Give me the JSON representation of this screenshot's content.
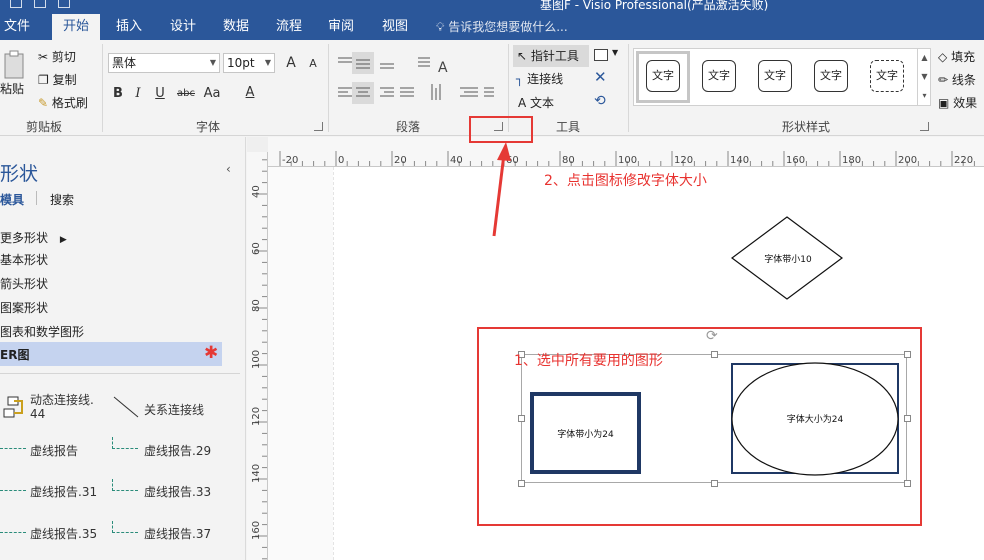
{
  "window": {
    "title": "基图F - Visio Professional(产品激活失败)"
  },
  "menu": {
    "tabs": [
      {
        "label": "文件",
        "active": false
      },
      {
        "label": "开始",
        "active": true
      },
      {
        "label": "插入",
        "active": false
      },
      {
        "label": "设计",
        "active": false
      },
      {
        "label": "数据",
        "active": false
      },
      {
        "label": "流程",
        "active": false
      },
      {
        "label": "审阅",
        "active": false
      },
      {
        "label": "视图",
        "active": false
      }
    ],
    "tell_me": "告诉我您想要做什么..."
  },
  "ribbon": {
    "clipboard": {
      "paste": "粘贴",
      "cut": "剪切",
      "copy": "复制",
      "format_painter": "格式刷",
      "label": "剪贴板"
    },
    "font": {
      "family": "黑体",
      "size": "10pt",
      "grow": "A",
      "shrink": "A",
      "bold": "B",
      "italic": "I",
      "underline": "U",
      "strike": "abc",
      "case": "Aa",
      "color": "A",
      "label": "字体"
    },
    "paragraph": {
      "label": "段落"
    },
    "tools": {
      "pointer": "指针工具",
      "connector": "连接线",
      "text": "文本",
      "label": "工具"
    },
    "shape_styles": {
      "swatch": "文字",
      "label": "形状样式"
    },
    "right": {
      "fill": "填充",
      "line": "线条",
      "effects": "效果"
    }
  },
  "sidebar": {
    "title": "形状",
    "tabs": {
      "stencils": "模具",
      "search": "搜索"
    },
    "items": [
      "更多形状",
      "基本形状",
      "箭头形状",
      "图案形状",
      "图表和数学图形"
    ],
    "active_stencil": "ER图",
    "stencil_shapes": [
      "动态连接线.",
      "44",
      "关系连接线",
      "虚线报告",
      "虚线报告.29",
      "虚线报告.31",
      "虚线报告.33",
      "虚线报告.35",
      "虚线报告.37"
    ]
  },
  "ruler": {
    "h_ticks": [
      "-20",
      "0",
      "20",
      "40",
      "60",
      "80",
      "100",
      "120",
      "140",
      "160",
      "180",
      "200",
      "220"
    ],
    "v_ticks": [
      "40",
      "60",
      "80",
      "100",
      "120",
      "140",
      "160"
    ]
  },
  "canvas": {
    "diamond_text": "字体带小10",
    "rect_text": "字体带小为24",
    "ellipse_text": "字体大小为24"
  },
  "annotations": {
    "step1": "1、选中所有要用的图形",
    "step2": "2、点击图标修改字体大小"
  },
  "colors": {
    "accent": "#2b579a",
    "annotation": "#e53935",
    "shape_border": "#1f3864"
  }
}
